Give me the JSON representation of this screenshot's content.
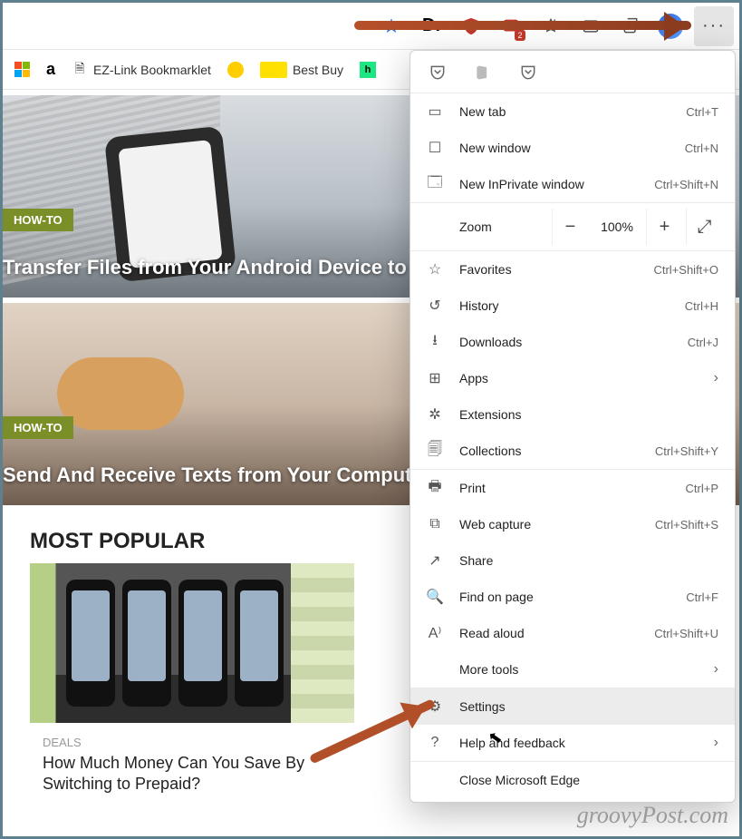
{
  "bookmarks": {
    "ezlink": "EZ-Link Bookmarklet",
    "bestbuy": "Best Buy"
  },
  "toolbar": {
    "msg_badge": "2"
  },
  "cards": [
    {
      "tag": "HOW-TO",
      "title": "Transfer Files from Your Android Device to Computer Over Wi-Fi"
    },
    {
      "tag": "HOW-TO",
      "title": "Send And Receive Texts from Your Computer With Google Messages"
    }
  ],
  "most_popular": {
    "heading": "MOST POPULAR",
    "category": "DEALS",
    "title": "How Much Money Can You Save By Switching to Prepaid?"
  },
  "menu": {
    "new_tab": {
      "label": "New tab",
      "acc": "Ctrl+T"
    },
    "new_window": {
      "label": "New window",
      "acc": "Ctrl+N"
    },
    "new_inprivate": {
      "label": "New InPrivate window",
      "acc": "Ctrl+Shift+N"
    },
    "zoom": {
      "label": "Zoom",
      "value": "100%"
    },
    "favorites": {
      "label": "Favorites",
      "acc": "Ctrl+Shift+O"
    },
    "history": {
      "label": "History",
      "acc": "Ctrl+H"
    },
    "downloads": {
      "label": "Downloads",
      "acc": "Ctrl+J"
    },
    "apps": {
      "label": "Apps"
    },
    "extensions": {
      "label": "Extensions"
    },
    "collections": {
      "label": "Collections",
      "acc": "Ctrl+Shift+Y"
    },
    "print": {
      "label": "Print",
      "acc": "Ctrl+P"
    },
    "web_capture": {
      "label": "Web capture",
      "acc": "Ctrl+Shift+S"
    },
    "share": {
      "label": "Share"
    },
    "find": {
      "label": "Find on page",
      "acc": "Ctrl+F"
    },
    "read_aloud": {
      "label": "Read aloud",
      "acc": "Ctrl+Shift+U"
    },
    "more_tools": {
      "label": "More tools"
    },
    "settings": {
      "label": "Settings"
    },
    "help": {
      "label": "Help and feedback"
    },
    "close": {
      "label": "Close Microsoft Edge"
    }
  },
  "watermark": "groovyPost.com"
}
